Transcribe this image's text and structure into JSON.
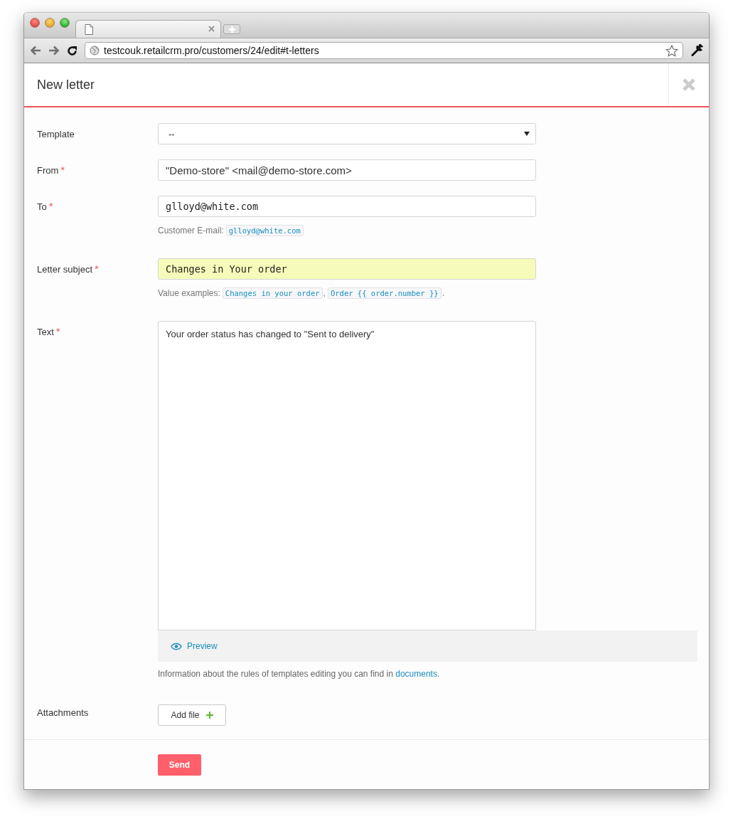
{
  "browser": {
    "address": "testcouk.retailcrm.pro/customers/24/edit#t-letters"
  },
  "dialog": {
    "title": "New letter"
  },
  "fields": [
    {
      "kind": "select",
      "label": "Template",
      "value": "--"
    },
    {
      "kind": "text",
      "label": "From",
      "required_mark": "*",
      "value": "\"Demo-store\" <mail@demo-store.com>"
    },
    {
      "kind": "mono",
      "label": "To",
      "required_mark": "*",
      "value": "glloyd@white.com",
      "hint": {
        "prefix": "Customer E-mail:",
        "codes": [
          "glloyd@white.com"
        ]
      }
    },
    {
      "kind": "mono",
      "label": "Letter subject",
      "required_mark": "*",
      "highlighted": true,
      "value": "Changes in Your order",
      "hint": {
        "prefix": "Value examples:",
        "codes": [
          "Changes in your order",
          "Order {{ order.number }}"
        ],
        "separator": ",",
        "suffix": "."
      }
    },
    {
      "kind": "textarea",
      "label": "Text",
      "required_mark": "*",
      "value": "Your order status has changed to \"Sent to delivery\""
    }
  ],
  "preview_button": "Preview",
  "info": {
    "text": "Information about the rules of templates editing you can find in ",
    "link": "documents",
    "suffix": "."
  },
  "attachments": {
    "label": "Attachments",
    "button": "Add file"
  },
  "send_button": "Send"
}
